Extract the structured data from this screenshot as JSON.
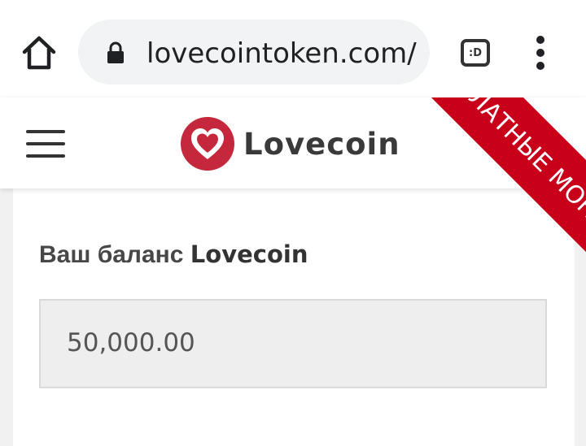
{
  "browser": {
    "url": "lovecointoken.com/",
    "tab_switcher_label": ":D"
  },
  "site": {
    "brand_name": "Lovecoin",
    "ribbon_text": "ЛАТНЫЕ МОН"
  },
  "balance": {
    "label_prefix": "Ваш баланс",
    "label_brand": "Lovecoin",
    "value": "50,000.00"
  },
  "colors": {
    "brand_red": "#c8001a",
    "logo_red": "#c5283c"
  },
  "icons": {
    "home": "home-icon",
    "lock": "lock-icon",
    "tabs": "tab-switcher-icon",
    "menu": "more-vert-icon",
    "hamburger": "hamburger-icon",
    "logo": "heart-logo-icon"
  }
}
